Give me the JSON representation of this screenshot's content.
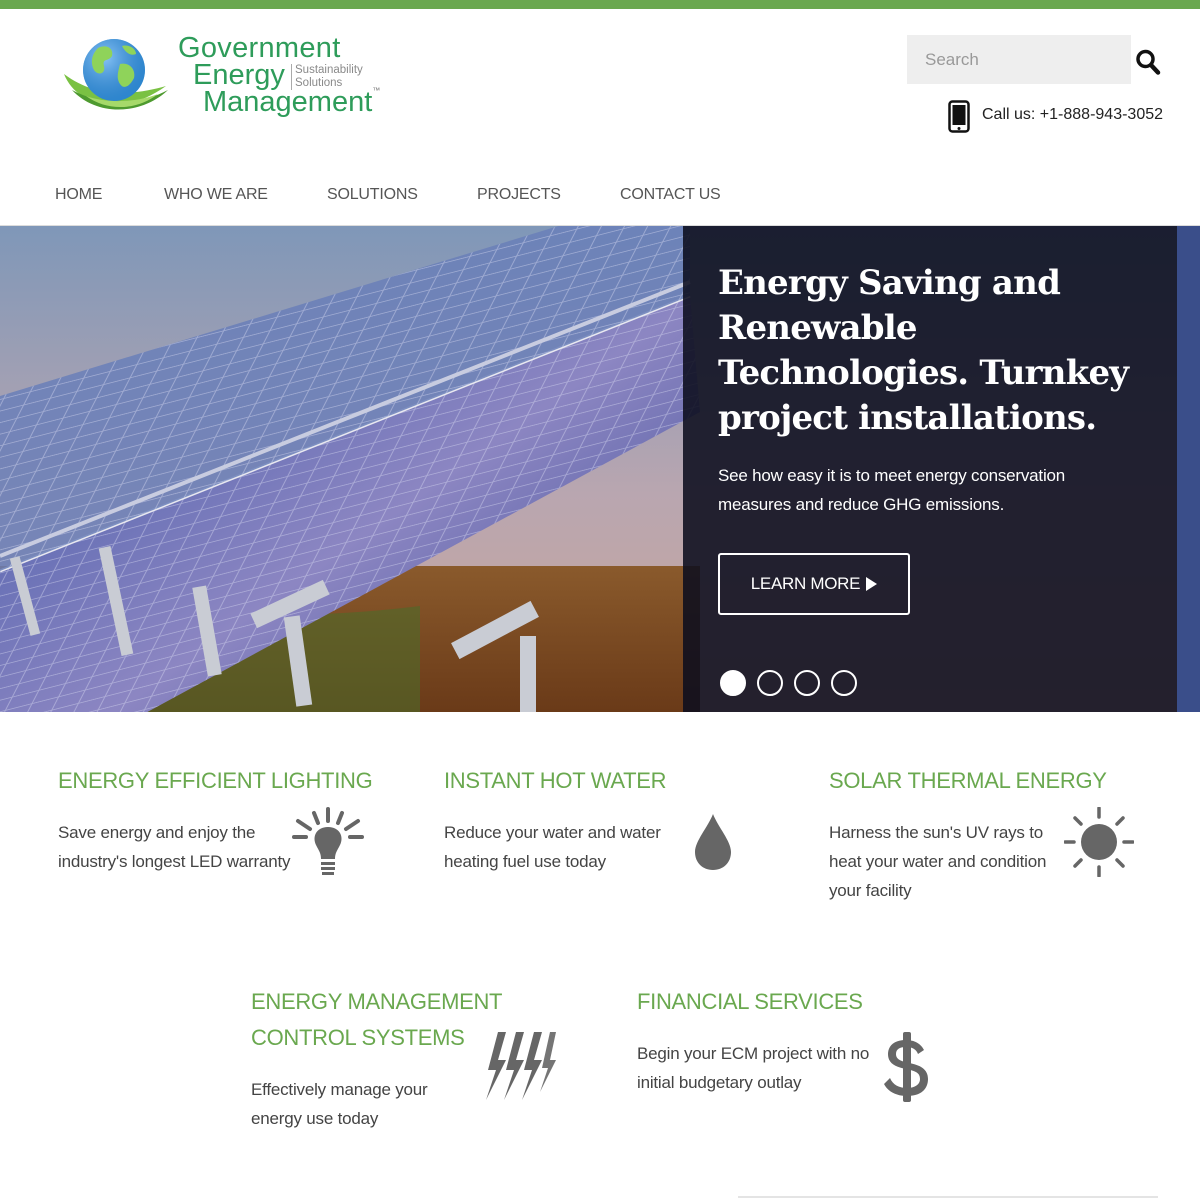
{
  "brand": {
    "line1": "Government",
    "line2": "Energy",
    "line3": "Management",
    "tag1": "Sustainability",
    "tag2": "Solutions",
    "tm": "™",
    "accent": "#6aa84f",
    "logo_green": "#2e9c5a"
  },
  "header": {
    "search_placeholder": "Search",
    "call_text": "Call us: +1-888-943-3052"
  },
  "nav": {
    "items": [
      {
        "label": "HOME"
      },
      {
        "label": "WHO WE ARE"
      },
      {
        "label": "SOLUTIONS"
      },
      {
        "label": "PROJECTS"
      },
      {
        "label": "CONTACT US"
      }
    ]
  },
  "hero": {
    "title": "Energy Saving and Renewable Technologies. Turnkey project installations.",
    "subtitle": "See how easy it is to meet energy conservation measures and reduce GHG emissions.",
    "button_label": "LEARN MORE",
    "slides_total": 4,
    "active_slide": 1
  },
  "features": [
    {
      "title": "ENERGY EFFICIENT LIGHTING",
      "desc": "Save energy and enjoy the industry's longest LED warranty",
      "icon": "lightbulb-icon"
    },
    {
      "title": "INSTANT HOT WATER",
      "desc": "Reduce your water and water heating fuel use today",
      "icon": "water-drop-icon"
    },
    {
      "title": "SOLAR THERMAL ENERGY",
      "desc": "Harness the sun's UV rays to heat your water and condition your facility",
      "icon": "sun-icon"
    },
    {
      "title_line1": "ENERGY MANAGEMENT",
      "title_line2": "CONTROL SYSTEMS",
      "desc": "Effectively manage your energy use today",
      "icon": "lightning-bolts-icon"
    },
    {
      "title": "FINANCIAL SERVICES",
      "desc": "Begin your ECM project with no initial budgetary outlay",
      "icon": "dollar-icon"
    }
  ]
}
